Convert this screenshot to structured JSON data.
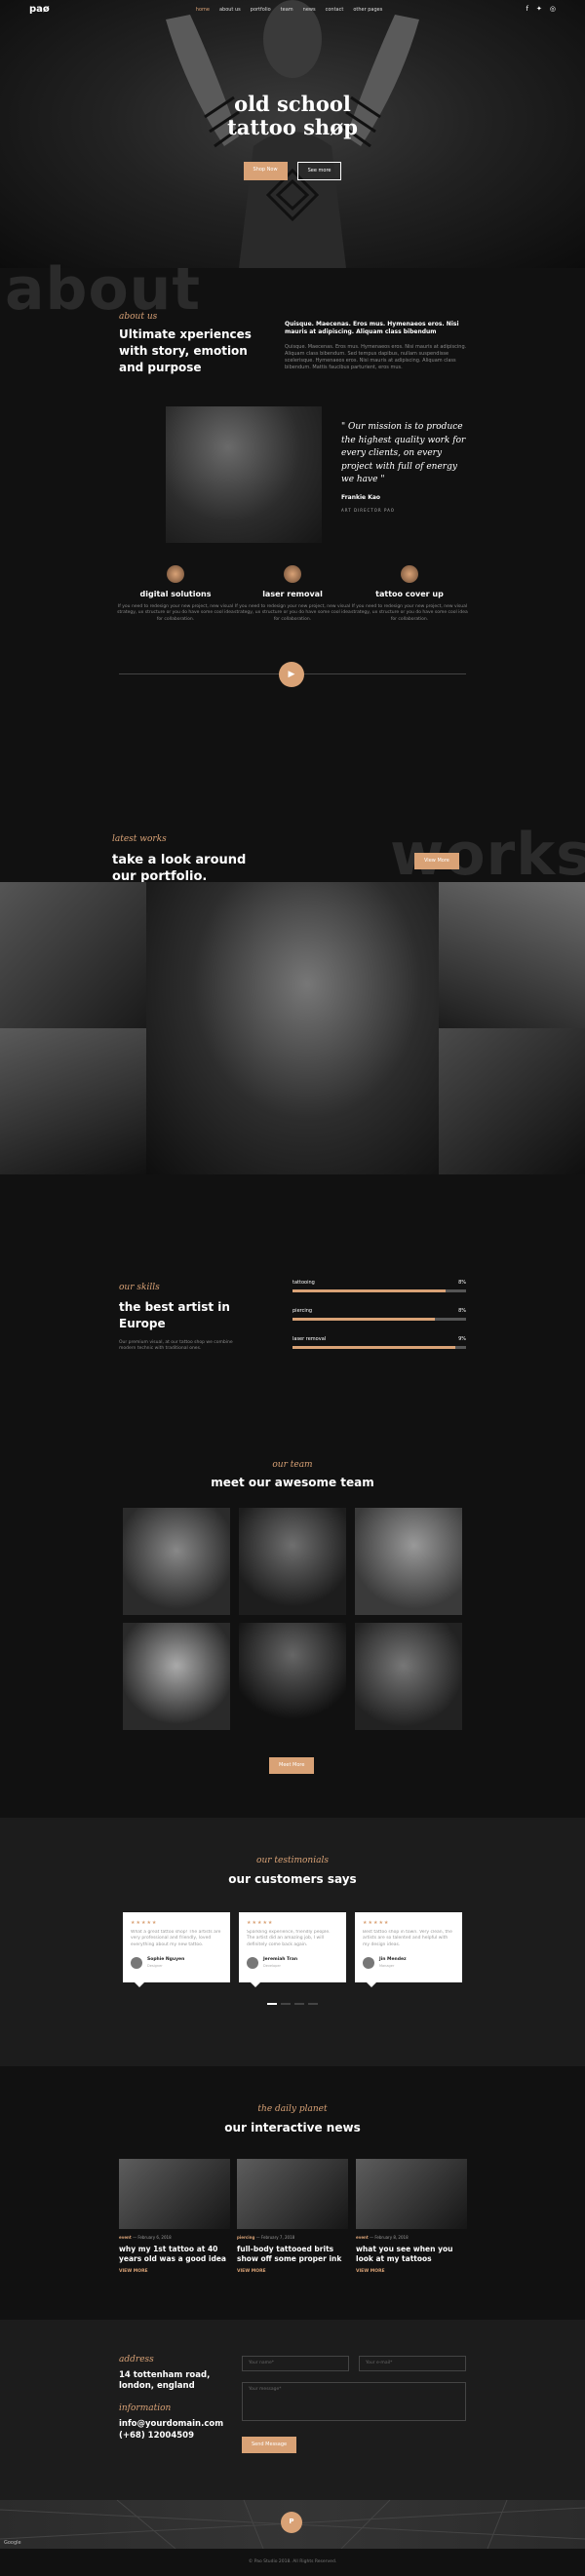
{
  "nav": {
    "logo": "paø",
    "links": [
      "home",
      "about us",
      "portfolio",
      "team",
      "news",
      "contact",
      "other pages"
    ],
    "social_icons": [
      "facebook-icon",
      "twitter-icon",
      "instagram-icon"
    ]
  },
  "hero": {
    "title_line1": "old school",
    "title_line2": "tattoo shøp",
    "primary_button": "Shop Now",
    "secondary_button": "See more"
  },
  "about": {
    "bg_word": "about",
    "eyebrow": "about us",
    "heading": "Ultimate xperiences with story, emotion and purpose",
    "subheading": "Quisque. Maecenas. Eros mus. Hymenaeos eros. Nisi mauris at adipiscing. Aliquam class bibendum",
    "paragraph": "Quisque. Maecenas. Eros mus. Hymenaeos eros. Nisi mauris at adipiscing. Aliquam class bibendum. Sed tempus dapibus, nullam suspendisse scelerisque. Hymenaeos eros. Nisi mauris at adipiscing. Aliquam class bibendum. Mattis faucibus parturient, eros mus.",
    "quote": "\" Our mission is to produce the highest quality work for every clients, on every project with full of energy we have \"",
    "author": "Frankie Kao",
    "role": "ART DIRECTOR PAO",
    "services": [
      {
        "title": "digital solutions",
        "text": "If you need to redesign your new project, new visual strategy, ux structure or you do have some cool idea for collaboration."
      },
      {
        "title": "laser removal",
        "text": "If you need to redesign your new project, new visual strategy, ux structure or you do have some cool idea for collaboration."
      },
      {
        "title": "tattoo cover up",
        "text": "If you need to redesign your new project, new visual strategy, ux structure or you do have some cool idea for collaboration."
      }
    ],
    "play_icon": "play-icon"
  },
  "works": {
    "eyebrow": "latest works",
    "heading_line1": "take a look around",
    "heading_line2": "our portfolio.",
    "view_more": "View More",
    "bg_word": "works"
  },
  "skills": {
    "eyebrow": "our skills",
    "heading": "the best artist in Europe",
    "text": "Our premium visual, at our tattoo shop we combine modern technic with traditional ones.",
    "items": [
      {
        "name": "tattooing",
        "value": "8%",
        "percent": 88
      },
      {
        "name": "piercing",
        "value": "8%",
        "percent": 82
      },
      {
        "name": "laser removal",
        "value": "9%",
        "percent": 94
      }
    ]
  },
  "team": {
    "eyebrow": "our team",
    "heading": "meet our awesome team",
    "button": "Meet More"
  },
  "testimonials": {
    "eyebrow": "our testimonials",
    "heading": "our customers says",
    "cards": [
      {
        "stars": "★★★★★",
        "text": "What a great tattoo shop! The artists are very professional and friendly, loved everything about my new tattoo.",
        "name": "Sophie Nguyen",
        "job": "Designer"
      },
      {
        "stars": "★★★★★",
        "text": "Sparkling experience, friendly people. The artist did an amazing job, I will definitely come back again.",
        "name": "Jeremiah Tran",
        "job": "Developer"
      },
      {
        "stars": "★★★★★",
        "text": "Best tattoo shop in town. Very clean, the artists are so talented and helpful with my design ideas.",
        "name": "Jin Mendez",
        "job": "Manager"
      }
    ]
  },
  "news": {
    "eyebrow": "the daily planet",
    "heading": "our interactive news",
    "posts": [
      {
        "category": "event",
        "date": "February 6, 2018",
        "title": "why my 1st tattoo at 40 years old was a good idea",
        "more": "VIEW MORE"
      },
      {
        "category": "piercing",
        "date": "February 7, 2018",
        "title": "full-body tattooed brits show off some proper ink",
        "more": "VIEW MORE"
      },
      {
        "category": "event",
        "date": "February 8, 2018",
        "title": "what you see when you look at my tattoos",
        "more": "VIEW MORE"
      }
    ]
  },
  "contact": {
    "address_label": "address",
    "address": "14 tottenham road, london, england",
    "info_label": "information",
    "email": "info@yourdomain.com",
    "phone": "(+68) 12004509",
    "name_placeholder": "Your name*",
    "email_placeholder": "Your e-mail*",
    "message_placeholder": "Your message*",
    "send_button": "Send Message"
  },
  "map": {
    "pin": "P",
    "google": "Google"
  },
  "footer": {
    "copyright": "© Pao Studio 2018. All Rights Reserved."
  }
}
